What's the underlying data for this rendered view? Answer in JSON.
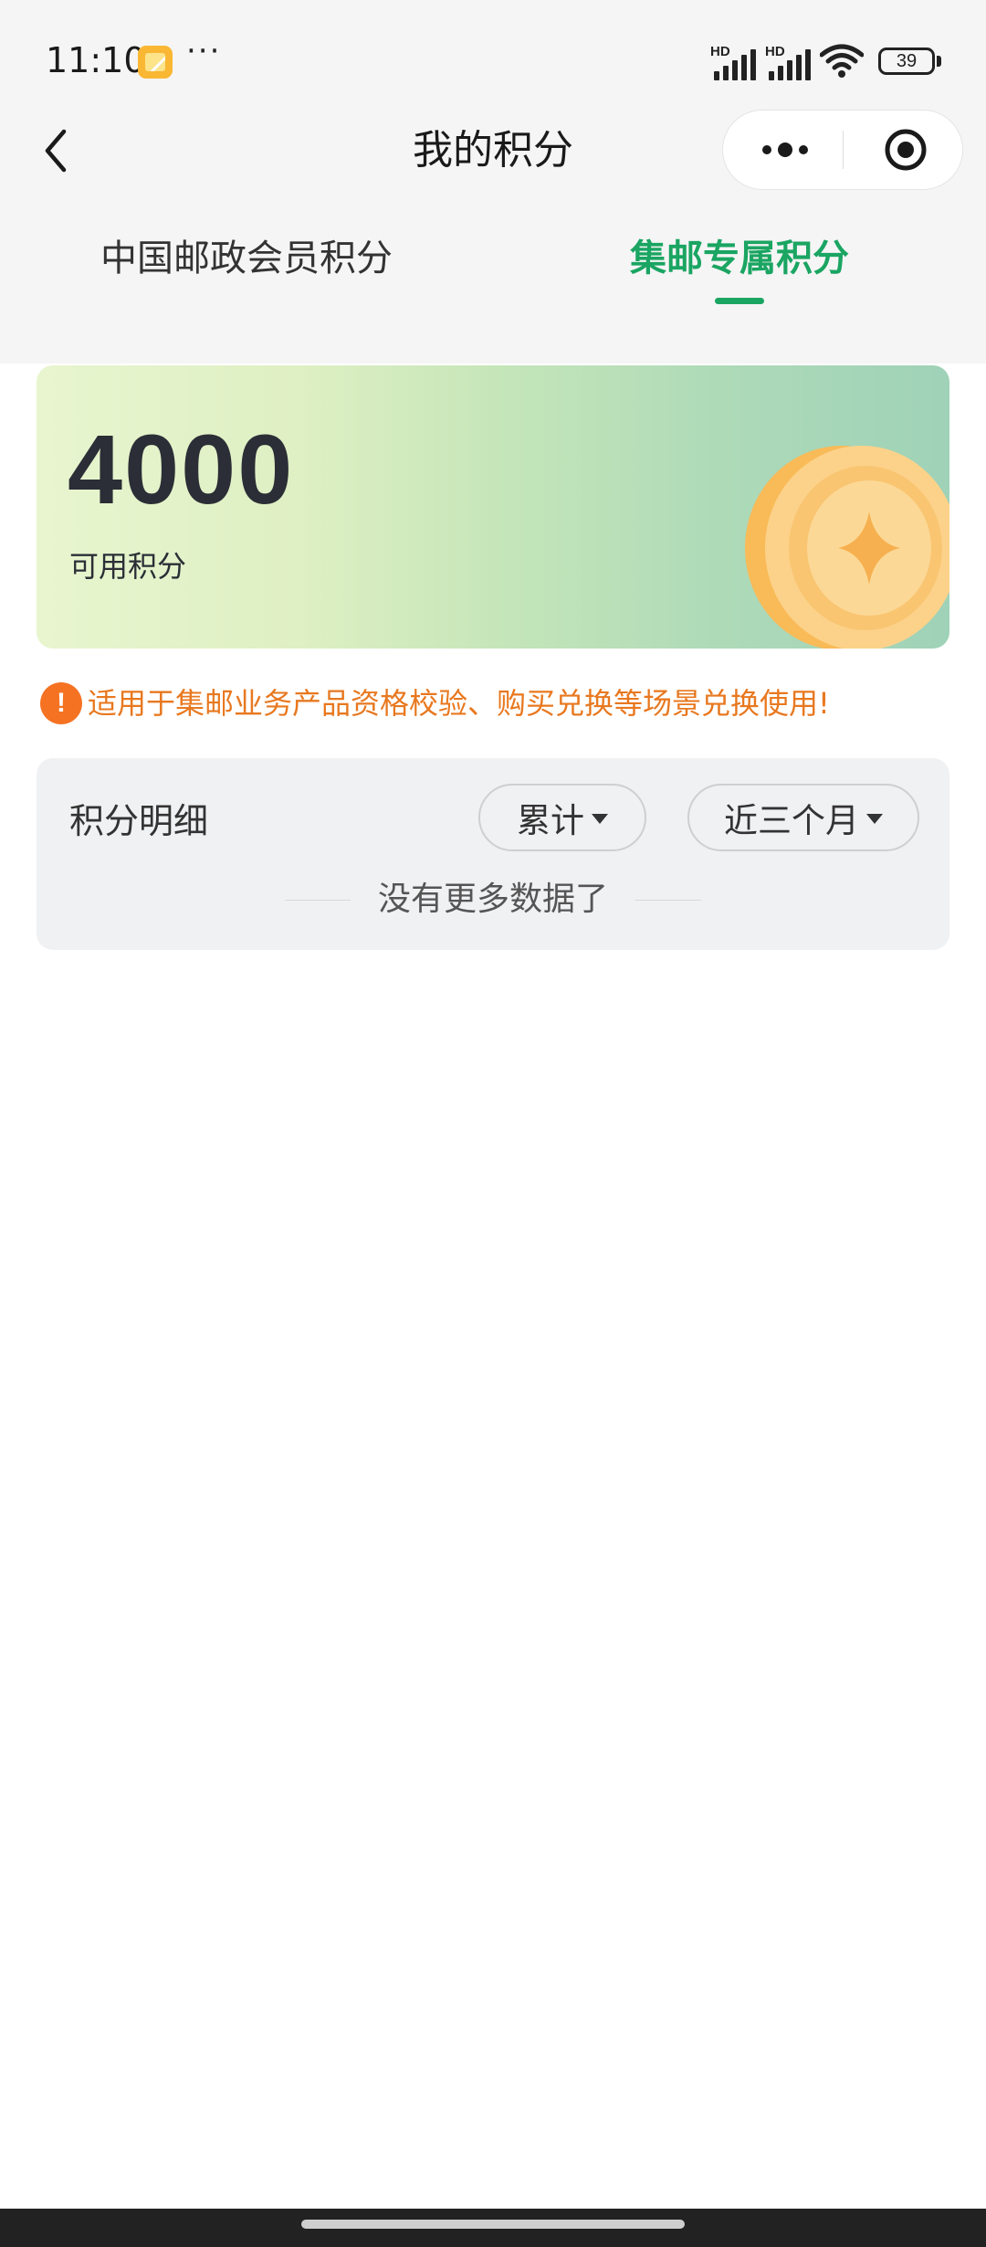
{
  "status_bar": {
    "time": "11:10",
    "app_icon": "notes-app-icon",
    "more": "···",
    "signal_1_label": "HD",
    "signal_2_label": "HD",
    "battery": "39"
  },
  "header": {
    "title": "我的积分",
    "back_icon": "chevron-left-icon",
    "more_icon": "more-dots-icon",
    "close_icon": "target-close-icon"
  },
  "tabs": [
    {
      "label": "中国邮政会员积分",
      "active": false
    },
    {
      "label": "集邮专属积分",
      "active": true
    }
  ],
  "points_card": {
    "value": "4000",
    "label": "可用积分"
  },
  "notice": {
    "icon_text": "!",
    "text": "适用于集邮业务产品资格校验、购买兑换等场景兑换使用!"
  },
  "detail": {
    "title": "积分明细",
    "filter_type": "累计",
    "filter_period": "近三个月",
    "empty_text": "没有更多数据了"
  },
  "colors": {
    "accent": "#1aa562",
    "notice": "#e8781f",
    "notice_icon": "#f57223"
  }
}
